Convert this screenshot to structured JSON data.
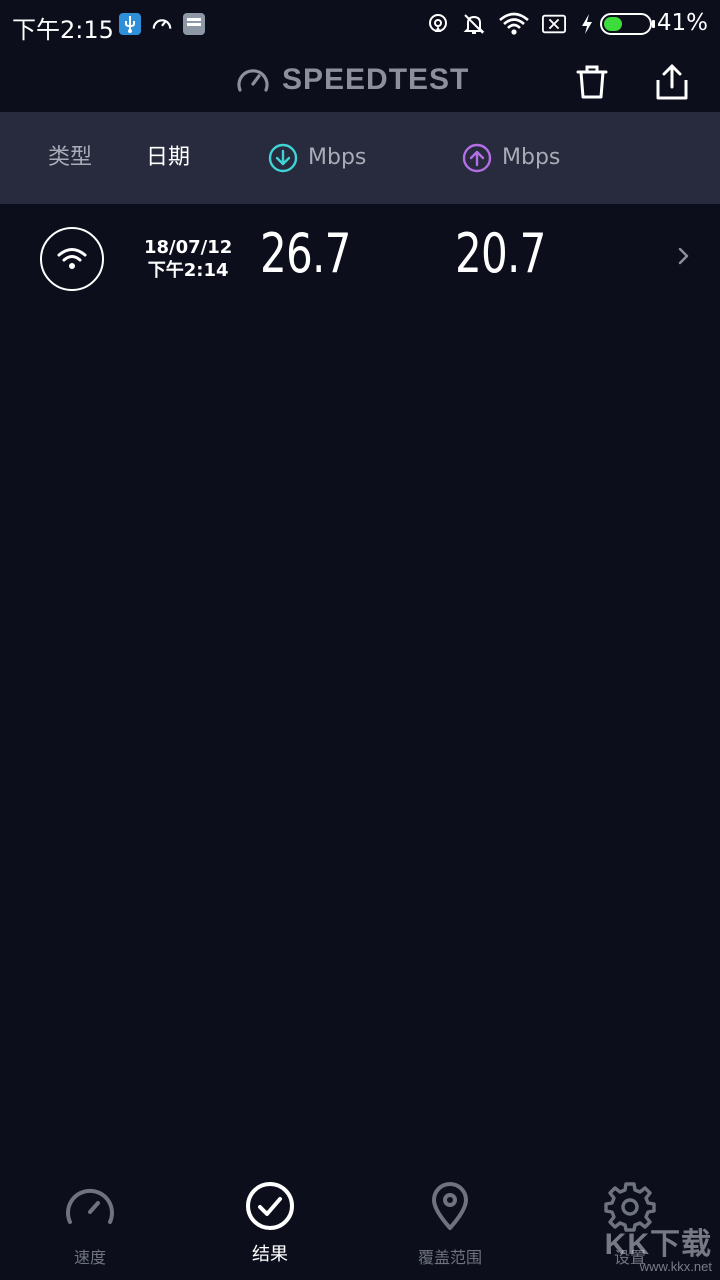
{
  "status_bar": {
    "time": "下午2:15",
    "battery_percent": "41%",
    "battery_level": 0.41,
    "battery_color": "#3ddc3d",
    "left_icons": [
      "usb-debug-icon",
      "speedometer-icon",
      "notes-icon"
    ],
    "right_icons": [
      "hotspot-icon",
      "bell-off-icon",
      "wifi-icon",
      "sim-x-icon",
      "charging-bolt-icon"
    ]
  },
  "header": {
    "logo_text": "SPEEDTEST",
    "actions": [
      "trash-icon",
      "share-icon"
    ]
  },
  "columns": {
    "type": "类型",
    "date": "日期",
    "download_unit": "Mbps",
    "upload_unit": "Mbps",
    "download_color": "#3fd3d6",
    "upload_color": "#b46ee6"
  },
  "results": [
    {
      "type_icon": "wifi-icon",
      "date": "18/07/12",
      "time": "下午2:14",
      "download": "26.7",
      "upload": "20.7"
    }
  ],
  "bottom_nav": {
    "items": [
      {
        "label": "速度",
        "icon": "speedometer-icon",
        "active": false
      },
      {
        "label": "结果",
        "icon": "check-circle-icon",
        "active": true
      },
      {
        "label": "覆盖范围",
        "icon": "map-pin-icon",
        "active": false
      },
      {
        "label": "设置",
        "icon": "gear-icon",
        "active": false
      }
    ]
  },
  "watermark": {
    "logo": "KK下载",
    "url": "www.kkx.net"
  }
}
